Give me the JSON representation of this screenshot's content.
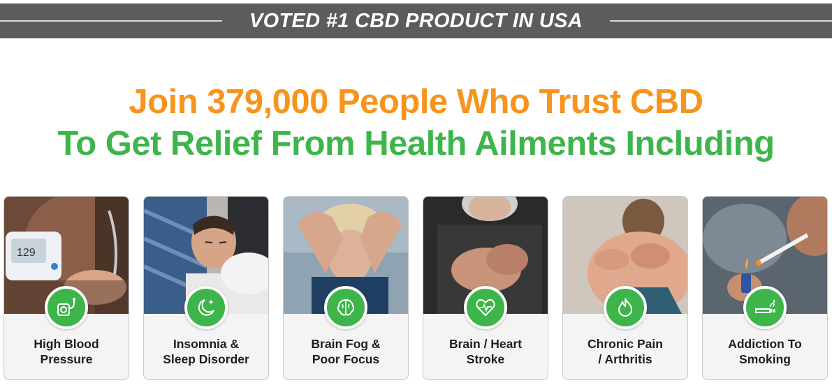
{
  "banner": {
    "text": "VOTED #1 CBD PRODUCT IN USA"
  },
  "headline": {
    "line1": "Join 379,000 People Who Trust CBD",
    "line2": "To Get Relief From Health Ailments Including"
  },
  "colors": {
    "orange": "#f7941d",
    "green": "#3db54a",
    "banner_bg": "#5c5c5c"
  },
  "ailments": [
    {
      "line1": "High Blood",
      "line2": "Pressure",
      "icon": "blood-pressure-icon"
    },
    {
      "line1": "Insomnia &",
      "line2": "Sleep Disorder",
      "icon": "moon-stars-icon"
    },
    {
      "line1": "Brain Fog &",
      "line2": "Poor Focus",
      "icon": "brain-icon"
    },
    {
      "line1": "Brain / Heart",
      "line2": "Stroke",
      "icon": "heart-pulse-icon"
    },
    {
      "line1": "Chronic Pain",
      "line2": "/ Arthritis",
      "icon": "flame-icon"
    },
    {
      "line1": "Addiction To",
      "line2": "Smoking",
      "icon": "cigarette-icon"
    }
  ]
}
